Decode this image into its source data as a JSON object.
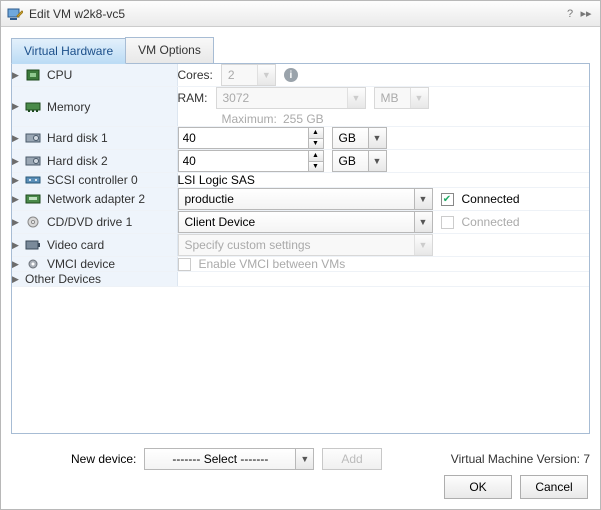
{
  "dialog": {
    "title": "Edit VM w2k8-vc5"
  },
  "tabs": {
    "hardware": "Virtual Hardware",
    "options": "VM Options"
  },
  "rows": {
    "cpu": {
      "label": "CPU",
      "field": "Cores:",
      "value": "2"
    },
    "mem": {
      "label": "Memory",
      "field": "RAM:",
      "value": "3072",
      "unit": "MB",
      "maxlabel": "Maximum:",
      "maxval": "255 GB"
    },
    "hd1": {
      "label": "Hard disk 1",
      "value": "40",
      "unit": "GB"
    },
    "hd2": {
      "label": "Hard disk 2",
      "value": "40",
      "unit": "GB"
    },
    "scsi": {
      "label": "SCSI controller 0",
      "value": "LSI Logic SAS"
    },
    "net": {
      "label": "Network adapter 2",
      "value": "productie",
      "connected": "Connected"
    },
    "cd": {
      "label": "CD/DVD drive 1",
      "value": "Client Device",
      "connected": "Connected"
    },
    "video": {
      "label": "Video card",
      "value": "Specify custom settings"
    },
    "vmci": {
      "label": "VMCI device",
      "option": "Enable VMCI between VMs"
    },
    "other": {
      "label": "Other Devices"
    }
  },
  "footer": {
    "newdevice": "New device:",
    "select_placeholder": "------- Select -------",
    "add": "Add",
    "version": "Virtual Machine Version: 7"
  },
  "buttons": {
    "ok": "OK",
    "cancel": "Cancel"
  }
}
